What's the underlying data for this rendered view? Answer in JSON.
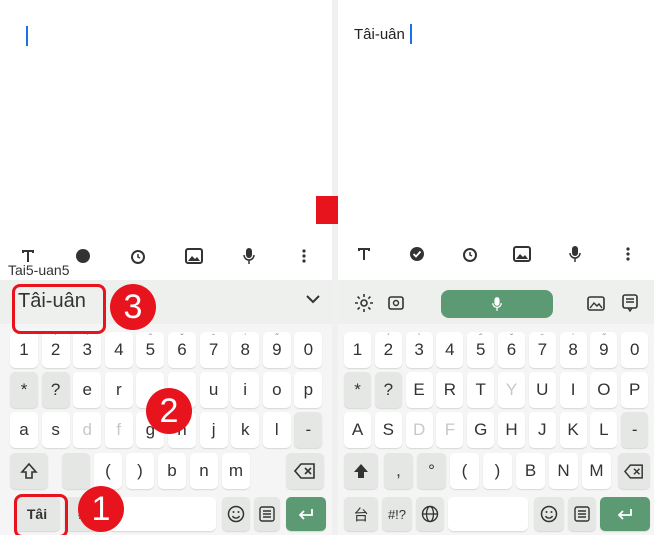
{
  "left": {
    "composing_text": "Tai5-uan5",
    "suggestion": "Tâi-uân",
    "mode_key": "Tâi",
    "symbol_key": "#!",
    "number_row": [
      {
        "k": "1",
        "h": ""
      },
      {
        "k": "2",
        "h": "ˊ"
      },
      {
        "k": "3",
        "h": "ˋ"
      },
      {
        "k": "4",
        "h": ""
      },
      {
        "k": "5",
        "h": "ˆ"
      },
      {
        "k": "6",
        "h": "ˇ"
      },
      {
        "k": "7",
        "h": "ˉ"
      },
      {
        "k": "8",
        "h": "ˈ"
      },
      {
        "k": "9",
        "h": "˝"
      },
      {
        "k": "0",
        "h": ""
      }
    ],
    "row1": [
      "*",
      "?",
      "e",
      "r",
      "",
      "",
      "u",
      "i",
      "o",
      "p"
    ],
    "row2": [
      "a",
      "s",
      "d",
      "f",
      "g",
      "h",
      "j",
      "k",
      "l",
      "-"
    ],
    "row3": [
      "",
      "(",
      ")",
      "b",
      "n",
      "m"
    ],
    "annotations": [
      "1",
      "2",
      "3"
    ]
  },
  "right": {
    "typed_text": "Tâi-uân",
    "number_row": [
      {
        "k": "1",
        "h": ""
      },
      {
        "k": "2",
        "h": "ˊ"
      },
      {
        "k": "3",
        "h": "ˋ"
      },
      {
        "k": "4",
        "h": ""
      },
      {
        "k": "5",
        "h": "ˆ"
      },
      {
        "k": "6",
        "h": "ˇ"
      },
      {
        "k": "7",
        "h": "ˉ"
      },
      {
        "k": "8",
        "h": "ˈ"
      },
      {
        "k": "9",
        "h": "˝"
      },
      {
        "k": "0",
        "h": ""
      }
    ],
    "row1": [
      "*",
      "?",
      "E",
      "R",
      "T",
      "Y",
      "U",
      "I",
      "O",
      "P"
    ],
    "row2": [
      "A",
      "S",
      "D",
      "F",
      "G",
      "H",
      "J",
      "K",
      "L",
      "-"
    ],
    "row3": [
      ",",
      "°",
      "(",
      ")",
      "B",
      "N",
      "M"
    ],
    "mode_key": "台",
    "symbol_key": "#!?"
  },
  "colors": {
    "accent": "#5b9a73",
    "annotation": "#e8141d",
    "caret": "#1a73e8"
  },
  "icons": [
    "text-format-icon",
    "check-circle-icon",
    "alarm-icon",
    "image-icon",
    "mic-icon",
    "more-vert-icon",
    "settings-icon",
    "translate-icon",
    "gallery-icon",
    "clipboard-icon",
    "shift-icon",
    "backspace-icon",
    "globe-icon",
    "emoji-icon",
    "keyboard-icon",
    "enter-icon",
    "chevron-down-icon"
  ]
}
